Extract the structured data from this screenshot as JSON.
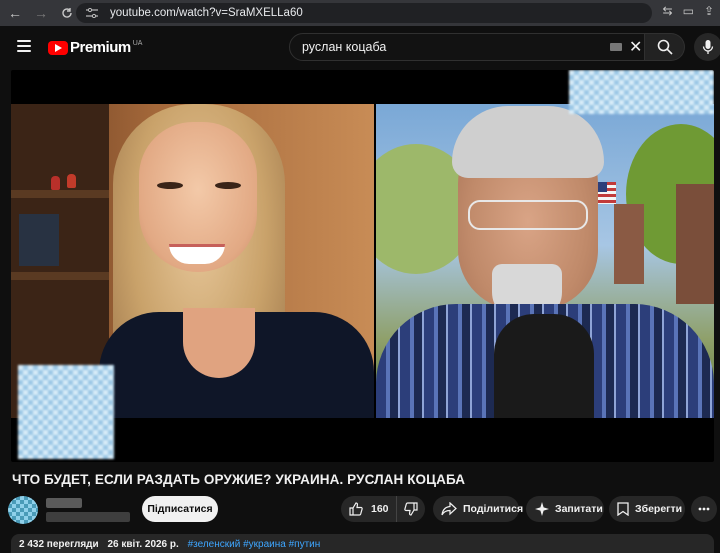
{
  "browser": {
    "url": "youtube.com/watch?v=SraMXELLa60"
  },
  "header": {
    "logo_text": "Premium",
    "logo_country": "UA",
    "search_query": "руслан коцаба"
  },
  "video": {
    "title": "ЧТО БУДЕТ, ЕСЛИ РАЗДАТЬ ОРУЖИЕ? УКРАИНА. РУСЛАН КОЦАБА"
  },
  "actions": {
    "subscribe_label": "Підписатися",
    "like_count": "160",
    "share_label": "Поділитися",
    "ask_label": "Запитати",
    "save_label": "Зберегти"
  },
  "description": {
    "views": "2 432 перегляди",
    "date": "26 квіт. 2026 р.",
    "hashtags": "#зеленский #украина #путин"
  },
  "colors": {
    "background": "#0f0f0f",
    "youtube_red": "#ff0000",
    "link_blue": "#3ea6ff",
    "pill_bg": "#272727"
  }
}
